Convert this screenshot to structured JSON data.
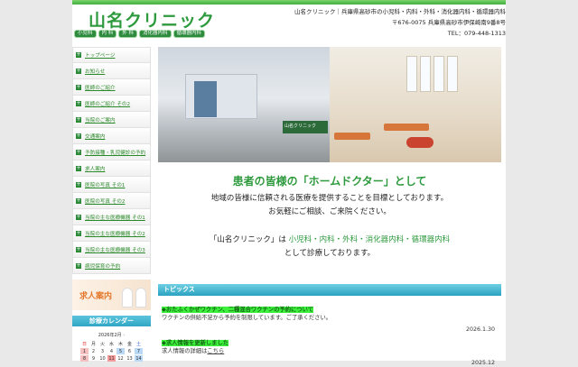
{
  "header": {
    "logo": "山名クリニック",
    "tags": [
      "小児科",
      "内 科",
      "外 科",
      "消化器内科",
      "循環器内科"
    ],
    "info_line": "山名クリニック｜兵庫県高砂市の小児科・内科・外科・消化器内科・循環器内科",
    "address": "〒676-0075 兵庫県高砂市伊保崎南9番8号",
    "tel": "TEL：079-448-1313"
  },
  "sidebar": {
    "items": [
      "トップページ",
      "お知らせ",
      "医師のご紹介",
      "医師のご紹介 その2",
      "当院のご案内",
      "交通案内",
      "予防接種・乳児健診の予約",
      "求人案内",
      "医院の写真 その1",
      "医院の写真 その2",
      "当院の主な医療機器 その1",
      "当院の主な医療機器 その2",
      "当院の主な医療機器 その3",
      "病児保育の予約"
    ],
    "recruit_banner": "求人案内",
    "calendar_title": "診療カレンダー",
    "calendar": {
      "month": "2026年2月",
      "next": "›",
      "weekdays": [
        "日",
        "月",
        "火",
        "水",
        "木",
        "金",
        "土"
      ],
      "week1": [
        "1",
        "2",
        "3",
        "4",
        "5",
        "6",
        "7"
      ],
      "week2": [
        "8",
        "9",
        "10",
        "11",
        "12",
        "13",
        "14"
      ]
    }
  },
  "hero": {
    "sign": "山名クリニック"
  },
  "main": {
    "heading": "患者の皆様の「ホームドクター」として",
    "line1": "地域の皆様に信頼される医療を提供することを目標としております。",
    "line2": "お気軽にご相談、ご来院ください。",
    "line3_a": "「山名クリニック」は",
    "line3_b": "小児科・内科・外科・消化器内科・循環器内科",
    "line4": "として診療しております。"
  },
  "topics": {
    "title": "トピックス",
    "items": [
      {
        "title": "◆おたふくかぜワクチン、二種混合ワクチンの予約について",
        "body": "ワクチンの供給不足から予約を制限しています。ご了承ください。",
        "date": "2026.1.30"
      },
      {
        "title": "◆求人情報を更新しました",
        "body": "求人情報の詳細は",
        "link": "こちら",
        "date": "2025.12"
      }
    ]
  }
}
